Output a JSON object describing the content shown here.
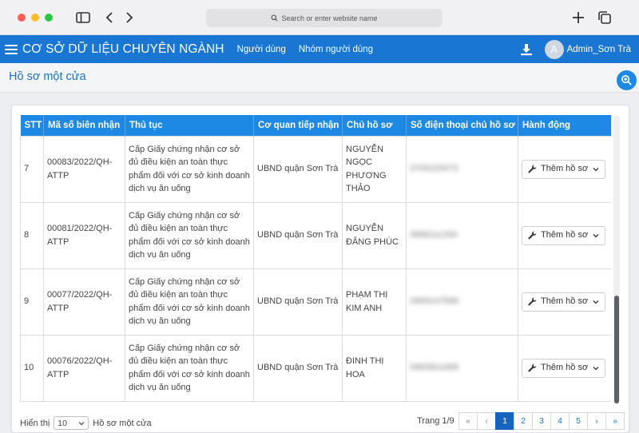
{
  "browser": {
    "url_placeholder": "Search or enter website name"
  },
  "header": {
    "brand": "CƠ SỞ DỮ LIỆU CHUYÊN NGÀNH",
    "nav": [
      "Người dùng",
      "Nhóm người dùng"
    ],
    "avatar_letter": "A",
    "user_name": "Admin_Sơn Trà",
    "color": "#1976d2"
  },
  "page": {
    "title": "Hồ sơ một cửa"
  },
  "table": {
    "columns": [
      "STT",
      "Mã số biên nhận",
      "Thủ tục",
      "Cơ quan tiếp nhận",
      "Chủ hồ sơ",
      "Số điện thoại chủ hồ sơ",
      "Hành động"
    ],
    "rows": [
      {
        "stt": "7",
        "receipt": "00083/2022/QH-ATTP",
        "procedure": "Cấp Giấy chứng nhận cơ sở đủ điều kiện an toàn thực phẩm đối với cơ sở kinh doanh dịch vụ ăn uống",
        "agency": "UBND quận Sơn Trà",
        "owner": "NGUYỄN NGỌC PHƯƠNG THẢO",
        "phone": "0705225072",
        "action": "Thêm hồ sơ"
      },
      {
        "stt": "8",
        "receipt": "00081/2022/QH-ATTP",
        "procedure": "Cấp Giấy chứng nhận cơ sở đủ điều kiện an toàn thực phẩm đối với cơ sở kinh doanh dịch vụ ăn uống",
        "agency": "UBND quận Sơn Trà",
        "owner": "NGUYỄN ĐĂNG PHÚC",
        "phone": "0868111334",
        "action": "Thêm hồ sơ"
      },
      {
        "stt": "9",
        "receipt": "00077/2022/QH-ATTP",
        "procedure": "Cấp Giấy chứng nhận cơ sở đủ điều kiện an toàn thực phẩm đối với cơ sở kinh doanh dịch vụ ăn uống",
        "agency": "UBND quận Sơn Trà",
        "owner": "PHẠM THỊ KIM ANH",
        "phone": "0906147589",
        "action": "Thêm hồ sơ"
      },
      {
        "stt": "10",
        "receipt": "00076/2022/QH-ATTP",
        "procedure": "Cấp Giấy chứng nhận cơ sở đủ điều kiện an toàn thực phẩm đối với cơ sở kinh doanh dịch vụ ăn uống",
        "agency": "UBND quận Sơn Trà",
        "owner": "ĐINH THỊ HOA",
        "phone": "0983601689",
        "action": "Thêm hồ sơ"
      }
    ]
  },
  "footer": {
    "show_label": "Hiển thị",
    "page_size": "10",
    "suffix_label": "Hồ sơ một cửa",
    "page_info": "Trang 1/9",
    "pager": [
      "«",
      "‹",
      "1",
      "2",
      "3",
      "4",
      "5",
      "›",
      "»"
    ],
    "active_page": "1"
  }
}
